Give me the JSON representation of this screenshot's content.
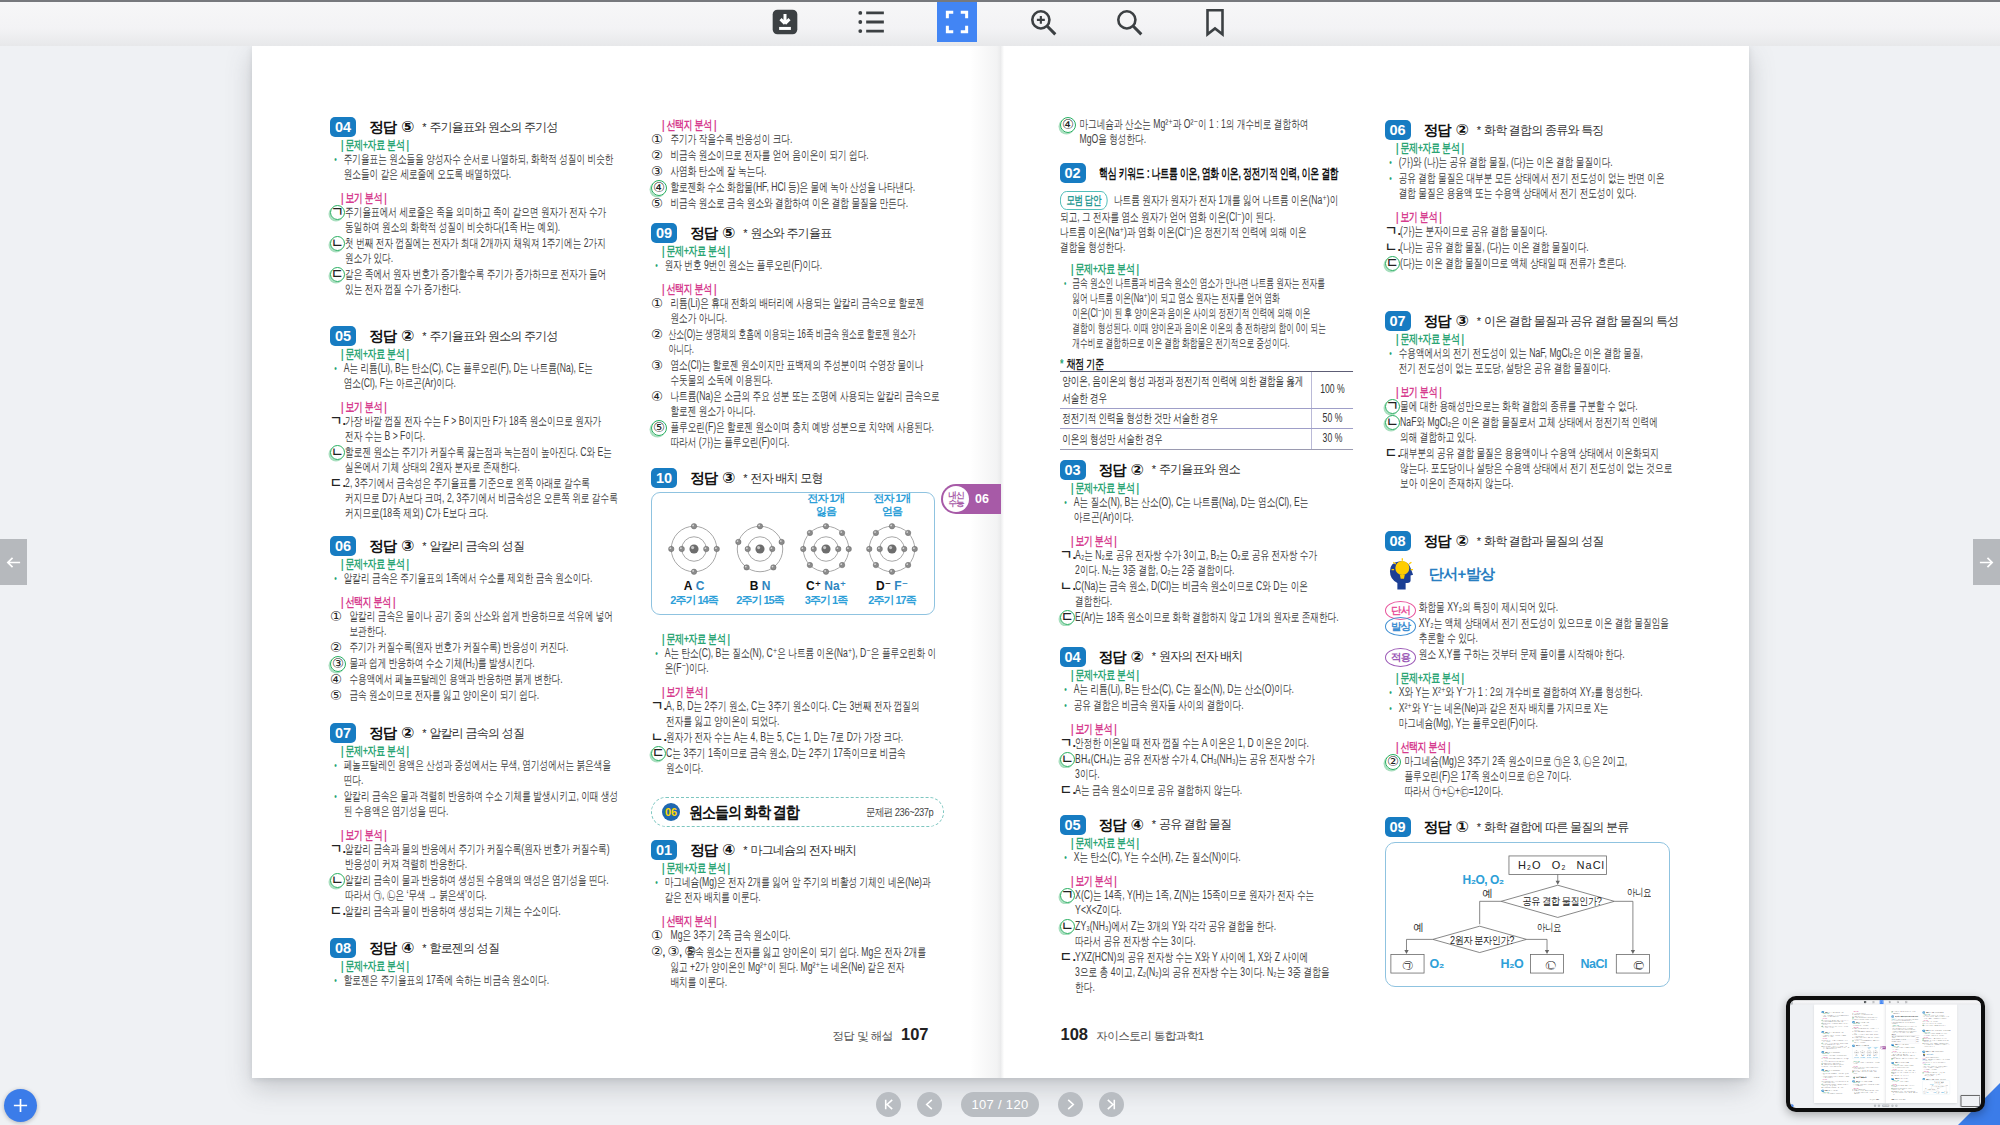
{
  "toolbar": {
    "buttons": [
      "download",
      "toc",
      "fullscreen",
      "zoom-in",
      "search",
      "bookmark"
    ],
    "active": "fullscreen"
  },
  "navigation": {
    "page_indicator": "107 / 120",
    "first": "|<",
    "prev": "<",
    "next": ">",
    "last": ">|"
  },
  "footers": {
    "left_label": "정답 및 해설",
    "left_page": "107",
    "right_page": "108",
    "right_label": "자이스토리 통합과학1"
  },
  "columns": {
    "c1": {
      "blocks": [
        {
          "t": "q",
          "num": "04",
          "lab": "정답",
          "ans": "⑤",
          "star": "*",
          "topic": "주기율표와 원소의 주기성"
        },
        {
          "t": "lab",
          "s": "g",
          "text": "| 문제+자료 분석 |"
        },
        {
          "t": "bu",
          "m": "•",
          "text": "주기율표는 원소들을 양성자수 순서로 나열하되, 화학적 성질이 비슷한\n원소들이 같은 세로줄에 오도록 배열하였다."
        },
        {
          "t": "lab",
          "s": "p",
          "text": "| 보기 분석 |"
        },
        {
          "t": "it",
          "m": "ㄱ",
          "a": 1,
          "text": "주기율표에서 세로줄은 족을 의미하고 족이 같으면 원자가 전자 수가\n동일하여 원소의 화학적 성질이 비슷하다(1족 H는 예외)."
        },
        {
          "t": "it",
          "m": "ㄴ",
          "a": 1,
          "text": "첫 번째 전자 껍질에는 전자가 최대 2개까지 채워져 1주기에는 2가지\n원소가 있다."
        },
        {
          "t": "it",
          "m": "ㄷ",
          "a": 1,
          "text": "같은 족에서 원자 번호가 증가할수록 주기가 증가하므로 전자가 들어\n있는 전자 껍질 수가 증가한다."
        },
        {
          "t": "q",
          "num": "05",
          "lab": "정답",
          "ans": "②",
          "star": "*",
          "topic": "주기율표와 원소의 주기성"
        },
        {
          "t": "lab",
          "s": "g",
          "text": "| 문제+자료 분석 |"
        },
        {
          "t": "bu",
          "m": "•",
          "text": "A는 리튬(Li), B는 탄소(C), C는 플루오린(F), D는 나트륨(Na), E는\n염소(Cl), F는 아르곤(Ar)이다."
        },
        {
          "t": "lab",
          "s": "p",
          "text": "| 보기 분석 |"
        },
        {
          "t": "it",
          "m": "ㄱ.",
          "a": 0,
          "text": "가장 바깥 껍질 전자 수는 F > B이지만 F가 18족 원소이므로 원자가\n전자 수는 B > F이다."
        },
        {
          "t": "it",
          "m": "ㄴ",
          "a": 1,
          "text": "할로젠 원소는 주기가 커질수록 끓는점과 녹는점이 높아진다. C와 E는 실온에서 기체 상태의 2원자 분자로 존재한다."
        },
        {
          "t": "it",
          "m": "ㄷ.",
          "a": 0,
          "text": "2, 3주기에서 금속성은 주기율표를 기준으로 왼쪽 아래로 갈수록\n커지므로 D가 A보다 크며, 2, 3주기에서 비금속성은 오른쪽 위로 갈수록\n커지므로(18족 제외) C가 E보다 크다."
        },
        {
          "t": "q",
          "num": "06",
          "lab": "정답",
          "ans": "③",
          "star": "*",
          "topic": "알칼리 금속의 성질"
        },
        {
          "t": "lab",
          "s": "g",
          "text": "| 문제+자료 분석 |"
        },
        {
          "t": "bu",
          "m": "•",
          "text": "알칼리 금속은 주기율표의 1족에서 수소를 제외한 금속 원소이다."
        },
        {
          "t": "lab",
          "s": "p",
          "text": "| 선택지 분석 |"
        },
        {
          "t": "nu",
          "m": "①",
          "a": 0,
          "text": "알칼리 금속은 물이나 공기 중의 산소와 쉽게 반응하므로 석유에 넣어 보관한다."
        },
        {
          "t": "nu",
          "m": "②",
          "a": 0,
          "text": "주기가 커질수록(원자 번호가 커질수록) 반응성이 커진다."
        },
        {
          "t": "nu",
          "m": "③",
          "a": 1,
          "text": "물과 쉽게 반응하여 수소 기체(H₂)를 발생시킨다."
        },
        {
          "t": "nu",
          "m": "④",
          "a": 0,
          "text": "수용액에서 페놀프탈레인 용액과 반응하면 붉게 변한다."
        },
        {
          "t": "nu",
          "m": "⑤",
          "a": 0,
          "text": "금속 원소이므로 전자를 잃고 양이온이 되기 쉽다."
        },
        {
          "t": "q",
          "num": "07",
          "lab": "정답",
          "ans": "②",
          "star": "*",
          "topic": "알칼리 금속의 성질"
        },
        {
          "t": "lab",
          "s": "g",
          "text": "| 문제+자료 분석 |"
        },
        {
          "t": "bu",
          "m": "•",
          "text": "페놀프탈레인 용액은 산성과 중성에서는 무색, 염기성에서는 붉은색을\n띤다."
        },
        {
          "t": "bu",
          "m": "•",
          "text": "알칼리 금속은 물과 격렬히 반응하여 수소 기체를 발생시키고, 이때 생성된 수용액은 염기성을 띤다."
        },
        {
          "t": "lab",
          "s": "p",
          "text": "| 보기 분석 |"
        },
        {
          "t": "it",
          "m": "ㄱ.",
          "a": 0,
          "text": "알칼리 금속과 물의 반응에서 주기가 커질수록(원자 번호가 커질수록)\n반응성이 커져 격렬히 반응한다."
        },
        {
          "t": "it",
          "m": "ㄴ",
          "a": 1,
          "text": "알칼리 금속이 물과 반응하여 생성된 수용액의 액성은 염기성을 띤다.\n따라서 ㉠, ㉡은 ‘무색 → 붉은색’이다."
        },
        {
          "t": "it",
          "m": "ㄷ.",
          "a": 0,
          "text": "알칼리 금속과 물이 반응하여 생성되는 기체는 수소이다."
        },
        {
          "t": "q",
          "num": "08",
          "lab": "정답",
          "ans": "④",
          "star": "*",
          "topic": "할로젠의 성질"
        },
        {
          "t": "lab",
          "s": "g",
          "text": "| 문제+자료 분석 |"
        },
        {
          "t": "bu",
          "m": "•",
          "text": "할로젠은 주기율표의 17족에 속하는 비금속 원소이다."
        }
      ]
    },
    "c2": {
      "blocks": [
        {
          "t": "lab",
          "s": "p",
          "text": "| 선택지 분석 |"
        },
        {
          "t": "nu",
          "m": "①",
          "a": 0,
          "text": "주기가 작을수록 반응성이 크다."
        },
        {
          "t": "nu",
          "m": "②",
          "a": 0,
          "text": "비금속 원소이므로 전자를 얻어 음이온이 되기 쉽다."
        },
        {
          "t": "nu",
          "m": "③",
          "a": 0,
          "text": "사염화 탄소에 잘 녹는다."
        },
        {
          "t": "nu",
          "m": "④",
          "a": 1,
          "text": "할로젠화 수소 화합물(HF, HCl 등)은 물에 녹아 산성을 나타낸다."
        },
        {
          "t": "nu",
          "m": "⑤",
          "a": 0,
          "text": "비금속 원소로 금속 원소와 결합하여 이온 결합 물질을 만든다."
        },
        {
          "t": "q",
          "num": "09",
          "lab": "정답",
          "ans": "⑤",
          "star": "*",
          "topic": "원소와 주기율표"
        },
        {
          "t": "lab",
          "s": "g",
          "text": "| 문제+자료 분석 |"
        },
        {
          "t": "bu",
          "m": "•",
          "text": "원자 번호 9번인 원소는 플루오린(F)이다."
        },
        {
          "t": "lab",
          "s": "p",
          "text": "| 선택지 분석 |"
        },
        {
          "t": "nu",
          "m": "①",
          "a": 0,
          "text": "리튬(Li)은 휴대 전화의 배터리에 사용되는 알칼리 금속으로 할로젠\n원소가 아니다."
        },
        {
          "t": "nu",
          "m": "②",
          "a": 0,
          "text": "산소(O)는 생명체의 호흡에 이용되는 16족 비금속 원소로 할로젠 원소가\n아니다.",
          "fit": 1
        },
        {
          "t": "nu",
          "m": "③",
          "a": 0,
          "text": "염소(Cl)는 할로젠 원소이지만 표백제의 주성분이며 수영장 물이나\n수돗물의 소독에 이용된다."
        },
        {
          "t": "nu",
          "m": "④",
          "a": 0,
          "text": "나트륨(Na)은 소금의 주요 성분 또는 조명에 사용되는 알칼리 금속으로 할로젠 원소가 아니다."
        },
        {
          "t": "nu",
          "m": "⑤",
          "a": 1,
          "text": "플루오린(F)은 할로젠 원소이며 충치 예방 성분으로 치약에 사용된다.\n따라서 (가)는 플루오린(F)이다."
        },
        {
          "t": "q",
          "num": "10",
          "lab": "정답",
          "ans": "③",
          "star": "*",
          "topic": "전자 배치 모형",
          "badge": {
            "line1": "내신",
            "line2": "수능",
            "num": "06"
          }
        },
        {
          "t": "atoms",
          "atoms": [
            {
              "sym": "A",
              "el": "C",
              "row": "2주기 14족",
              "note": "",
              "shells": [
                2,
                4
              ]
            },
            {
              "sym": "B",
              "el": "N",
              "row": "2주기 15족",
              "note": "",
              "shells": [
                2,
                5
              ]
            },
            {
              "sym": "C⁺",
              "el": "Na⁺",
              "row": "3주기 1족",
              "note": "전자 1개\n잃음",
              "shells": [
                2,
                8
              ]
            },
            {
              "sym": "D⁻",
              "el": "F⁻",
              "row": "2주기 17족",
              "note": "전자 1개\n얻음",
              "shells": [
                2,
                8
              ]
            }
          ]
        },
        {
          "t": "lab",
          "s": "g",
          "text": "| 문제+자료 분석 |"
        },
        {
          "t": "bu",
          "m": "•",
          "text": "A는 탄소(C), B는 질소(N), C⁺은 나트륨 이온(Na⁺), D⁻은 플루오린화 이온(F⁻)이다."
        },
        {
          "t": "lab",
          "s": "p",
          "text": "| 보기 분석 |"
        },
        {
          "t": "it",
          "m": "ㄱ.",
          "a": 0,
          "text": "A, B, D는 2주기 원소, C는 3주기 원소이다. C는 3번째 전자 껍질의\n전자를 잃고 양이온이 되었다."
        },
        {
          "t": "it",
          "m": "ㄴ.",
          "a": 0,
          "text": "원자가 전자 수는 A는 4, B는 5, C는 1, D는 7로 D가 가장 크다."
        },
        {
          "t": "it",
          "m": "ㄷ",
          "a": 1,
          "text": "C는 3주기 1족이므로 금속 원소, D는 2주기 17족이므로 비금속\n원소이다."
        },
        {
          "t": "band",
          "num": "06",
          "title": "원소들의 화학 결합",
          "ref": "문제편 236~237p"
        },
        {
          "t": "q",
          "num": "01",
          "lab": "정답",
          "ans": "④",
          "star": "*",
          "topic": "마그네슘의 전자 배치"
        },
        {
          "t": "lab",
          "s": "g",
          "text": "| 문제+자료 분석 |"
        },
        {
          "t": "bu",
          "m": "•",
          "text": "마그네슘(Mg)은 전자 2개를 잃어 앞 주기의 비활성 기체인 네온(Ne)과\n같은 전자 배치를 이룬다."
        },
        {
          "t": "lab",
          "s": "p",
          "text": "| 선택지 분석 |"
        },
        {
          "t": "nu",
          "m": "①",
          "a": 0,
          "text": "Mg은 3주기 2족 금속 원소이다."
        },
        {
          "t": "nu",
          "m": "②, ③, ⑤",
          "a": 0,
          "text": "금속 원소는 전자를 잃고 양이온이 되기 쉽다. Mg은 전자 2개를\n잃고 +2가 양이온인 Mg²⁺이 된다. Mg²⁺는 네온(Ne) 같은 전자\n배치를 이룬다."
        }
      ]
    },
    "c3": {
      "blocks": [
        {
          "t": "nu",
          "m": "④",
          "a": 1,
          "text": "마그네슘과 산소는 Mg²⁺과 O²⁻이 1 : 1의 개수비로 결합하여\nMgO을 형성한다."
        },
        {
          "t": "qk",
          "num": "02",
          "title": "핵심 키워드 : 나트륨 이온, 염화 이온, 정전기적 인력, 이온 결합"
        },
        {
          "t": "model",
          "badge": "모범 답안",
          "text": "나트륨 원자가 원자가 전자 1개를 잃어 나트륨 이온(Na⁺)이\n되고, 그 전자를 염소 원자가 얻어 염화 이온(Cl⁻)이 된다.\n나트륨 이온(Na⁺)과 염화 이온(Cl⁻)은 정전기적 인력에 의해 이온\n결합을 형성한다."
        },
        {
          "t": "lab",
          "s": "g",
          "text": "| 문제+자료 분석 |"
        },
        {
          "t": "bu",
          "m": "•",
          "text": "금속 원소인 나트륨과 비금속 원소인 염소가 만나면 나트륨 원자는 전자를\n잃어 나트륨 이온(Na⁺)이 되고 염소 원자는 전자를 얻어 염화\n이온(Cl⁻)이 된 후 양이온과 음이온 사이의 정전기적 인력에 의해 이온\n결합이 형성된다. 이때 양이온과 음이온 이온의 총 전하량의 합이 0이 되는\n개수비로 결합하므로 이온 결합 화합물은 전기적으로 중성이다.",
          "fit": 1
        },
        {
          "t": "grading",
          "title": "채점 기준",
          "star": "*",
          "rows": [
            {
              "c": "양이온, 음이온의 형성 과정과 정전기적 인력에 의한 결합을 옳게 서술한 경우",
              "p": "100 %"
            },
            {
              "c": "정전기적 인력을 형성한 것만 서술한 경우",
              "p": "50 %"
            },
            {
              "c": "이온의 형성만 서술한 경우",
              "p": "30 %"
            }
          ]
        },
        {
          "t": "q",
          "num": "03",
          "lab": "정답",
          "ans": "②",
          "star": "*",
          "topic": "주기율표와 원소"
        },
        {
          "t": "lab",
          "s": "g",
          "text": "| 문제+자료 분석 |"
        },
        {
          "t": "bu",
          "m": "•",
          "text": "A는 질소(N), B는 산소(O), C는 나트륨(Na), D는 염소(Cl), E는\n아르곤(Ar)이다."
        },
        {
          "t": "lab",
          "s": "p",
          "text": "| 보기 분석 |"
        },
        {
          "t": "it",
          "m": "ㄱ.",
          "a": 0,
          "text": "A₂는 N₂로 공유 전자쌍 수가 3이고, B₂는 O₂로 공유 전자쌍 수가\n2이다. N₂는 3중 결합, O₂는 2중 결합이다."
        },
        {
          "t": "it",
          "m": "ㄴ.",
          "a": 0,
          "text": "C(Na)는 금속 원소, D(Cl)는 비금속 원소이므로 C와 D는 이온\n결합한다."
        },
        {
          "t": "it",
          "m": "ㄷ",
          "a": 1,
          "text": "E(Ar)는 18족 원소이므로 화학 결합하지 않고 1개의 원자로 존재한다."
        },
        {
          "t": "q",
          "num": "04",
          "lab": "정답",
          "ans": "②",
          "star": "*",
          "topic": "원자의 전자 배치"
        },
        {
          "t": "lab",
          "s": "g",
          "text": "| 문제+자료 분석 |"
        },
        {
          "t": "bu",
          "m": "•",
          "text": "A는 리튬(Li), B는 탄소(C), C는 질소(N), D는 산소(O)이다."
        },
        {
          "t": "bu",
          "m": "•",
          "text": "공유 결합은 비금속 원자들 사이의 결합이다."
        },
        {
          "t": "lab",
          "s": "p",
          "text": "| 보기 분석 |"
        },
        {
          "t": "it",
          "m": "ㄱ.",
          "a": 0,
          "text": "안정한 이온일 때 전자 껍질 수는 A 이온은 1, D 이온은 2이다."
        },
        {
          "t": "it",
          "m": "ㄴ",
          "a": 1,
          "text": "BH₄(CH₄)는 공유 전자쌍 수가 4, CH₃(NH₃)는 공유 전자쌍 수가\n3이다."
        },
        {
          "t": "it",
          "m": "ㄷ.",
          "a": 0,
          "text": "A는 금속 원소이므로 공유 결합하지 않는다."
        },
        {
          "t": "q",
          "num": "05",
          "lab": "정답",
          "ans": "④",
          "star": "*",
          "topic": "공유 결합 물질"
        },
        {
          "t": "lab",
          "s": "g",
          "text": "| 문제+자료 분석 |"
        },
        {
          "t": "bu",
          "m": "•",
          "text": "X는 탄소(C), Y는 수소(H), Z는 질소(N)이다."
        },
        {
          "t": "lab",
          "s": "p",
          "text": "| 보기 분석 |"
        },
        {
          "t": "it",
          "m": "ㄱ",
          "a": 1,
          "text": "X(C)는 14족, Y(H)는 1족, Z(N)는 15족이므로 원자가 전자 수는\nY<X<Z이다."
        },
        {
          "t": "it",
          "m": "ㄴ",
          "a": 1,
          "text": "ZY₃(NH₃)에서 Z는 3개의 Y와 각각 공유 결합을 한다.\n따라서 공유 전자쌍 수는 3이다."
        },
        {
          "t": "it",
          "m": "ㄷ.",
          "a": 0,
          "text": "YXZ(HCN)의 공유 전자쌍 수는 X와 Y 사이에 1, X와 Z 사이에\n3으로 총 4이고, Z₂(N₂)의 공유 전자쌍 수는 3이다. N₂는 3중 결합을\n한다."
        }
      ]
    },
    "c4": {
      "blocks": [
        {
          "t": "q",
          "num": "06",
          "lab": "정답",
          "ans": "②",
          "star": "*",
          "topic": "화학 결합의 종류와 특징"
        },
        {
          "t": "lab",
          "s": "g",
          "text": "| 문제+자료 분석 |"
        },
        {
          "t": "bu",
          "m": "•",
          "text": "(가)와 (나)는 공유 결합 물질, (다)는 이온 결합 물질이다."
        },
        {
          "t": "bu",
          "m": "•",
          "text": "공유 결합 물질은 대부분 모든 상태에서 전기 전도성이 없는 반면 이온\n결합 물질은 용융액 또는 수용액 상태에서 전기 전도성이 있다."
        },
        {
          "t": "lab",
          "s": "p",
          "text": "| 보기 분석 |"
        },
        {
          "t": "it",
          "m": "ㄱ.",
          "a": 0,
          "text": "(가)는 분자이므로 공유 결합 물질이다."
        },
        {
          "t": "it",
          "m": "ㄴ.",
          "a": 0,
          "text": "(나)는 공유 결합 물질, (다)는 이온 결합 물질이다."
        },
        {
          "t": "it",
          "m": "ㄷ",
          "a": 1,
          "text": "(다)는 이온 결합 물질이므로 액체 상태일 때 전류가 흐른다."
        },
        {
          "t": "q",
          "num": "07",
          "lab": "정답",
          "ans": "③",
          "star": "*",
          "topic": "이온 결합 물질과 공유 결합 물질의 특성"
        },
        {
          "t": "lab",
          "s": "g",
          "text": "| 문제+자료 분석 |"
        },
        {
          "t": "bu",
          "m": "•",
          "text": "수용액에서의 전기 전도성이 있는 NaF, MgCl₂은 이온 결합 물질,\n전기 전도성이 없는 포도당, 설탕은 공유 결합 물질이다."
        },
        {
          "t": "lab",
          "s": "p",
          "text": "| 보기 분석 |"
        },
        {
          "t": "it",
          "m": "ㄱ",
          "a": 1,
          "text": "물에 대한 용해성만으로는 화학 결합의 종류를 구분할 수 없다."
        },
        {
          "t": "it",
          "m": "ㄴ",
          "a": 1,
          "text": "NaF와 MgCl₂은 이온 결합 물질로서 고체 상태에서 정전기적 인력에\n의해 결합하고 있다."
        },
        {
          "t": "it",
          "m": "ㄷ.",
          "a": 0,
          "text": "대부분의 공유 결합 물질은 용융액이나 수용액 상태에서 이온화되지\n않는다. 포도당이나 설탕은 수용액 상태에서 전기 전도성이 없는 것으로\n보아 이온이 존재하지 않는다."
        },
        {
          "t": "q",
          "num": "08",
          "lab": "정답",
          "ans": "②",
          "star": "*",
          "topic": "화학 결합과 물질의 성질"
        },
        {
          "t": "clue",
          "head": "단서+발상",
          "items": [
            {
              "tag": "단서",
              "s": "pink",
              "text": "화합물 XY₂의 특징이 제시되어 있다."
            },
            {
              "tag": "발상",
              "s": "blue",
              "text": "XY₂는 액체 상태에서 전기 전도성이 있으므로 이온 결합 물질임을 추론할 수 있다."
            },
            {
              "tag": "적용",
              "s": "purple",
              "text": "원소 X,Y를 구하는 것부터 문제 풀이를 시작해야 한다."
            }
          ]
        },
        {
          "t": "lab",
          "s": "g",
          "text": "| 문제+자료 분석 |"
        },
        {
          "t": "bu",
          "m": "•",
          "text": "X와 Y는 X²⁺와 Y⁻가 1 : 2의 개수비로 결합하여 XY₂를 형성한다."
        },
        {
          "t": "bu",
          "m": "•",
          "text": "X²⁺와 Y⁻는 네온(Ne)과 같은 전자 배치를 가지므로 X는\n마그네슘(Mg), Y는 플루오린(F)이다."
        },
        {
          "t": "lab",
          "s": "p",
          "text": "| 선택지 분석 |"
        },
        {
          "t": "nu",
          "m": "②",
          "a": 1,
          "text": "마그네슘(Mg)은 3주기 2족 원소이므로 ㉠은 3, ㉡은 2이고,\n플루오린(F)은 17족 원소이므로 ㉢은 7이다.\n따라서 ㉠+㉡+㉢=12이다."
        },
        {
          "t": "q",
          "num": "09",
          "lab": "정답",
          "ans": "①",
          "star": "*",
          "topic": "화학 결합에 따른 물질의 분류"
        },
        {
          "t": "flow",
          "source": "H₂O    O₂    NaCl",
          "q1": "공유 결합 물질인가?",
          "q2": "2원자 분자인가?",
          "yes1": "예",
          "no1": "아니요",
          "yes2": "예",
          "no2": "아니요",
          "branch": "H₂O, O₂",
          "r1": "㉠",
          "r1v": "O₂",
          "r2": "㉡",
          "r2v": "H₂O",
          "r3": "㉢",
          "r3v": "NaCl"
        }
      ]
    }
  }
}
